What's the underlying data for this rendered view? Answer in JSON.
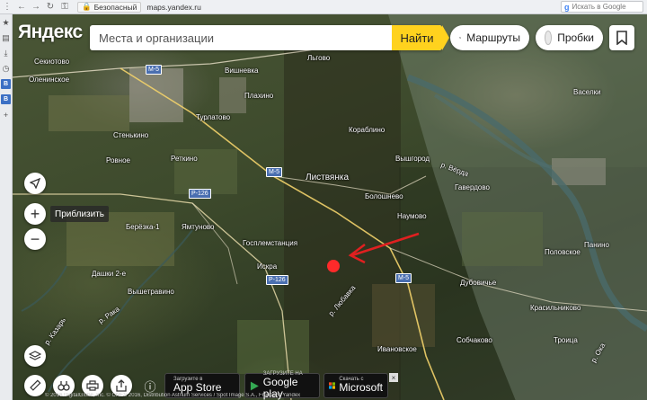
{
  "browser": {
    "secure_label": "Безопасный",
    "url": "maps.yandex.ru",
    "search_placeholder": "Искать в Google"
  },
  "header": {
    "logo": "Яндекс",
    "search_placeholder": "Места и организации",
    "find_label": "Найти",
    "routes_label": "Маршруты",
    "traffic_label": "Пробки"
  },
  "controls": {
    "zoom_tooltip": "Приблизить"
  },
  "stores": {
    "apple_small": "Загрузите в",
    "apple_big": "App Store",
    "google_small": "ЗАГРУЗИТЕ НА",
    "google_big": "Google play",
    "ms_small": "Скачать с",
    "ms_big": "Microsoft"
  },
  "map": {
    "places": {
      "sekiotovo": "Секиотово",
      "oleninskoe": "Оленинское",
      "m5_a": "М-5",
      "vishnevka": "Вишневка",
      "lgovo": "Льгово",
      "vaselki": "Васелки",
      "plakhino": "Плахино",
      "turlatovo": "Турлатово",
      "korablino": "Кораблино",
      "stenkino": "Стенькино",
      "rovnoe": "Ровное",
      "retkino": "Реткино",
      "vyshgorod": "Вышгород",
      "m5_b": "М-5",
      "listvyanka": "Листвянка",
      "gaverdovo": "Гавердово",
      "r126_a": "Р-126",
      "bolotnevo": "Болошнево",
      "naumovo": "Наумово",
      "berezka": "Берёзка-1",
      "yamtunovo": "Ямтуново",
      "panino": "Панино",
      "poloyevskoe": "Половское",
      "gosplemstantsiya": "Госплемстанция",
      "dashki": "Дашки 2-е",
      "iskra": "Искра",
      "m5_c": "М-5",
      "r126_b": "Р-126",
      "vyshetravino": "Вышетравино",
      "lyubavka": "р. Любавка",
      "dubovichye": "Дубовичье",
      "krasilnikovo": "Красильниково",
      "rakha": "р. Рака",
      "kazar": "р. Казарь",
      "sobchakovo": "Собчаково",
      "troitsa": "Троица",
      "ivanovskoe": "Ивановское",
      "vakha": "р. Вёрда",
      "oka": "р. Ока"
    }
  },
  "footer": {
    "copyright": "© 2016 DigitalGlobe, Inc. © CNES 2016, Distribution Astrium Services / Spot Image S.A., France © Yandex"
  }
}
